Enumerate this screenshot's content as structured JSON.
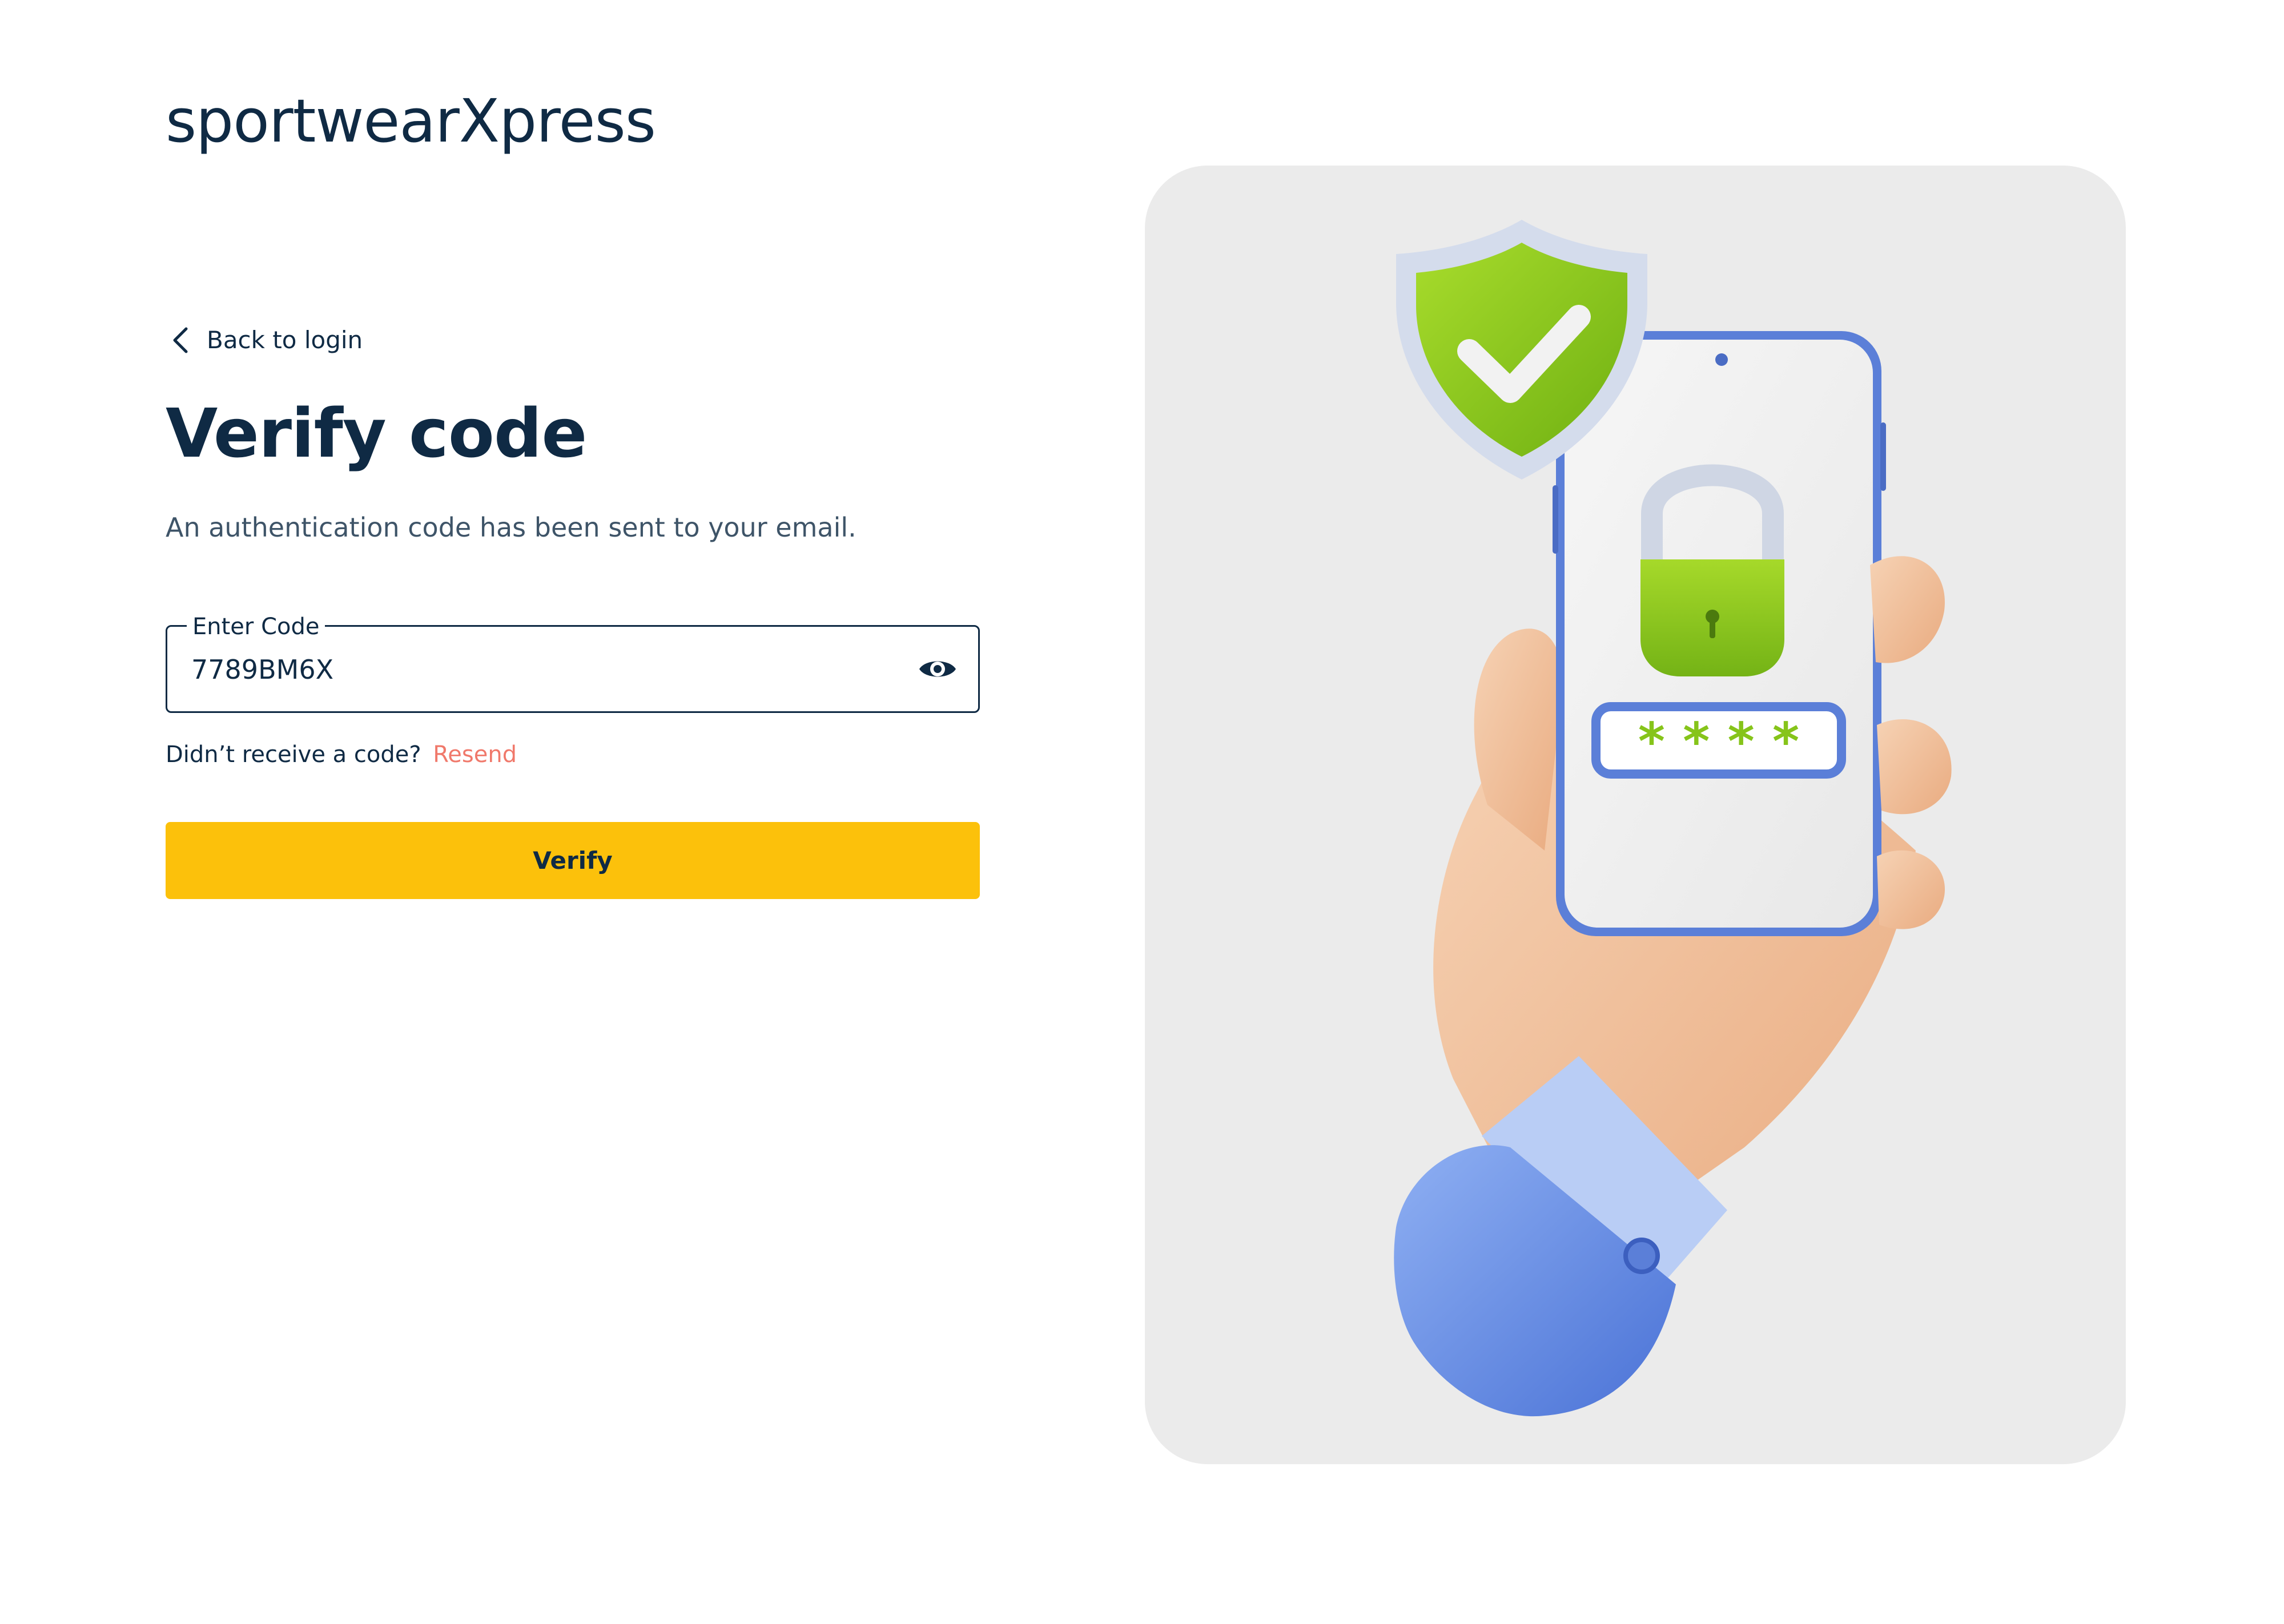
{
  "brand": {
    "name": "sportwearXpress"
  },
  "nav": {
    "back_label": "Back to login"
  },
  "main": {
    "title": "Verify code",
    "subtitle": "An authentication code has been sent to your email.",
    "code_field": {
      "label": "Enter Code",
      "value": "7789BM6X"
    },
    "resend": {
      "prompt": "Didn’t receive a code?",
      "link_label": "Resend"
    },
    "verify_button_label": "Verify"
  },
  "illustration": {
    "password_mask": "* * * *"
  },
  "colors": {
    "navy": "#0f2a44",
    "accent_yellow": "#fcc10b",
    "resend_link": "#f0796b",
    "illustration_bg": "#ebebeb",
    "shield_green": "#8fcc1a",
    "phone_blue": "#5b7fd8"
  },
  "icons": {
    "back": "chevron-left-icon",
    "visibility": "eye-icon",
    "shield": "shield-check-icon",
    "lock": "padlock-icon"
  }
}
